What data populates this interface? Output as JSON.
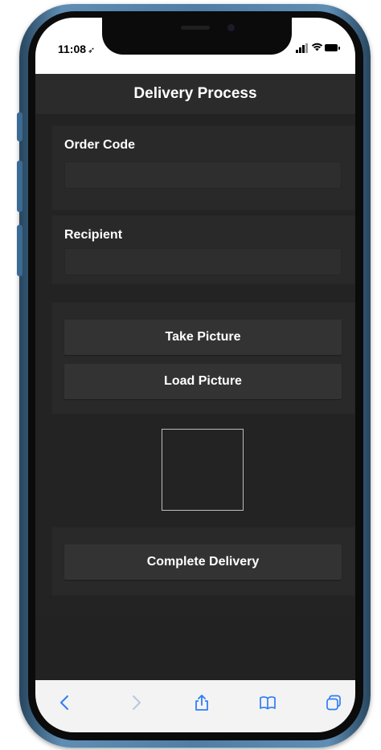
{
  "status_bar": {
    "time": "11:08",
    "location_glyph": "➶"
  },
  "header": {
    "title": "Delivery Process"
  },
  "form": {
    "order_code": {
      "label": "Order Code",
      "value": "",
      "placeholder": ""
    },
    "recipient": {
      "label": "Recipient",
      "value": "",
      "placeholder": ""
    }
  },
  "buttons": {
    "take_picture": "Take Picture",
    "load_picture": "Load Picture",
    "complete_delivery": "Complete Delivery"
  },
  "browser_toolbar": {
    "icons": [
      "back-icon",
      "forward-icon",
      "share-icon",
      "bookmarks-icon",
      "tabs-icon"
    ],
    "accent_color": "#2f7df6"
  },
  "theme": {
    "background": "#232323",
    "card": "#292929",
    "button": "#333333",
    "text": "#ffffff",
    "device_frame": "#4f7ea6"
  }
}
